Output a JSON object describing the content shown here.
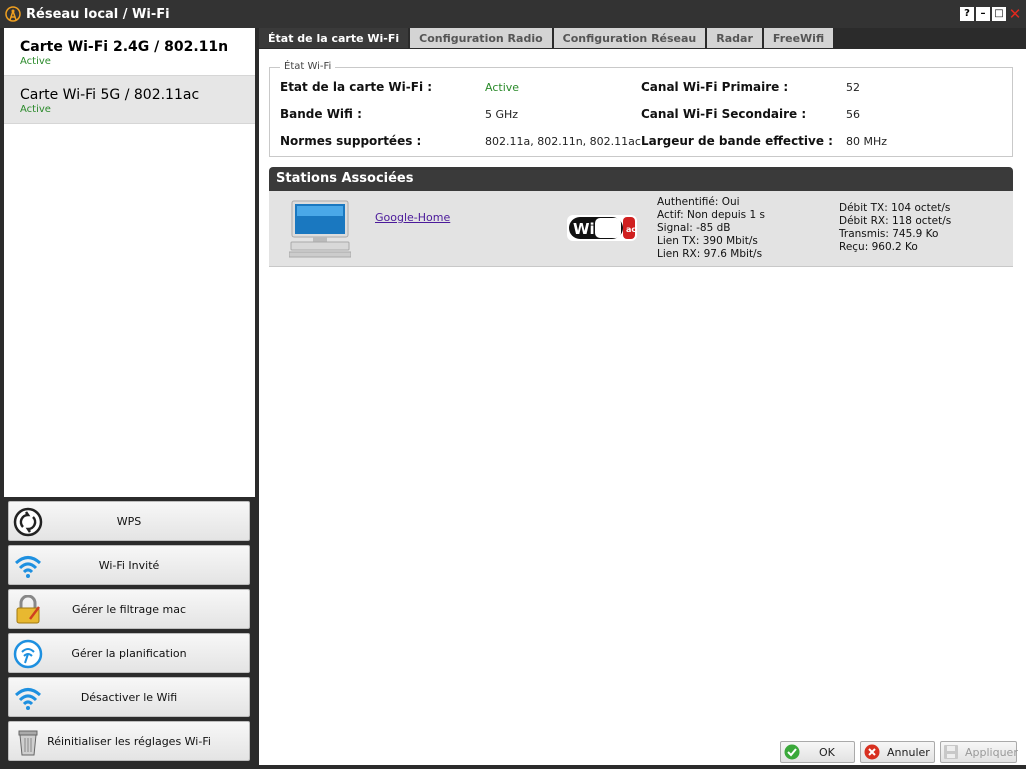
{
  "window": {
    "title": "Réseau local / Wi-Fi",
    "controls": {
      "help": "?",
      "minimize": "–",
      "maximize": "□",
      "close": "✕"
    }
  },
  "cards": [
    {
      "name": "Carte Wi-Fi 2.4G / 802.11n",
      "status": "Active"
    },
    {
      "name": "Carte Wi-Fi 5G / 802.11ac",
      "status": "Active"
    }
  ],
  "actions": [
    {
      "label": "WPS",
      "icon": "wps-icon"
    },
    {
      "label": "Wi-Fi Invité",
      "icon": "wifi-icon"
    },
    {
      "label": "Gérer le filtrage mac",
      "icon": "padlock-icon"
    },
    {
      "label": "Gérer la planification",
      "icon": "clock-wifi-icon"
    },
    {
      "label": "Désactiver le Wifi",
      "icon": "wifi-icon"
    },
    {
      "label": "Réinitialiser les réglages Wi-Fi",
      "icon": "trash-icon"
    }
  ],
  "tabs": [
    "État de la carte Wi-Fi",
    "Configuration Radio",
    "Configuration Réseau",
    "Radar",
    "FreeWifi"
  ],
  "status_panel": {
    "legend": "État Wi-Fi",
    "rows": [
      {
        "label1": "Etat de la carte Wi-Fi :",
        "value1": "Active",
        "label2": "Canal Wi-Fi Primaire :",
        "value2": "52"
      },
      {
        "label1": "Bande Wifi :",
        "value1": "5 GHz",
        "label2": "Canal Wi-Fi Secondaire :",
        "value2": "56"
      },
      {
        "label1": "Normes supportées :",
        "value1": "802.11a, 802.11n, 802.11ac",
        "label2": "Largeur de bande effective :",
        "value2": "80 MHz"
      }
    ]
  },
  "stations": {
    "header": "Stations Associées",
    "items": [
      {
        "name": "Google-Home",
        "badge_text": "WiFi",
        "badge_sub": "ac",
        "info": [
          "Authentifié: Oui",
          "Actif: Non depuis 1 s",
          "Signal: -85 dB",
          "Lien TX: 390 Mbit/s",
          "Lien RX: 97.6 Mbit/s"
        ],
        "traffic": [
          "Débit TX: 104 octet/s",
          "Débit RX: 118 octet/s",
          "Transmis: 745.9 Ko",
          "Reçu: 960.2 Ko"
        ]
      }
    ]
  },
  "buttons": {
    "ok": "OK",
    "cancel": "Annuler",
    "apply": "Appliquer"
  },
  "colors": {
    "accent_green": "#2a8a2a",
    "link": "#4b1a9a",
    "dark": "#3a3a3a"
  }
}
